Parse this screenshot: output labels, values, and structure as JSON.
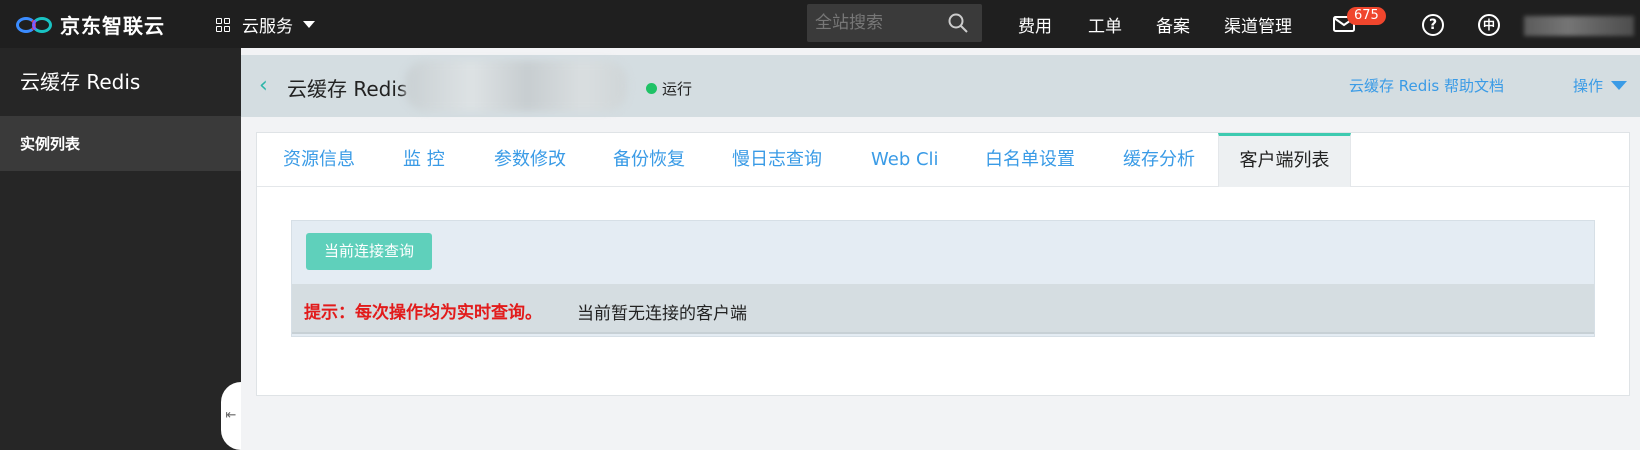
{
  "topbar": {
    "logo_text": "京东智联云",
    "cloud_services": "云服务",
    "search_placeholder": "全站搜索",
    "nav": {
      "fee": "费用",
      "ticket": "工单",
      "record": "备案",
      "channel": "渠道管理"
    },
    "mail_badge": "675",
    "help_symbol": "?",
    "lang_symbol": "中"
  },
  "sidebar": {
    "title": "云缓存 Redis",
    "items": [
      {
        "label": "实例列表"
      }
    ],
    "collapse_symbol": "⇤"
  },
  "header": {
    "back_symbol": "‹",
    "instance_title": "云缓存 Redis",
    "status": "运行",
    "help_link": "云缓存 Redis 帮助文档",
    "ops_label": "操作"
  },
  "tabs": [
    {
      "label": "资源信息"
    },
    {
      "label": "监 控"
    },
    {
      "label": "参数修改"
    },
    {
      "label": "备份恢复"
    },
    {
      "label": "慢日志查询"
    },
    {
      "label": "Web Cli"
    },
    {
      "label": "白名单设置"
    },
    {
      "label": "缓存分析"
    },
    {
      "label": "客户端列表"
    }
  ],
  "active_tab": "客户端列表",
  "content": {
    "query_button": "当前连接查询",
    "tip": "提示：每次操作均为实时查询。",
    "empty_message": "当前暂无连接的客户端"
  },
  "colors": {
    "accent_teal": "#5fd0bb",
    "link_blue": "#3a9be6",
    "warning_red": "#e21b1b",
    "status_green": "#1fc266"
  }
}
